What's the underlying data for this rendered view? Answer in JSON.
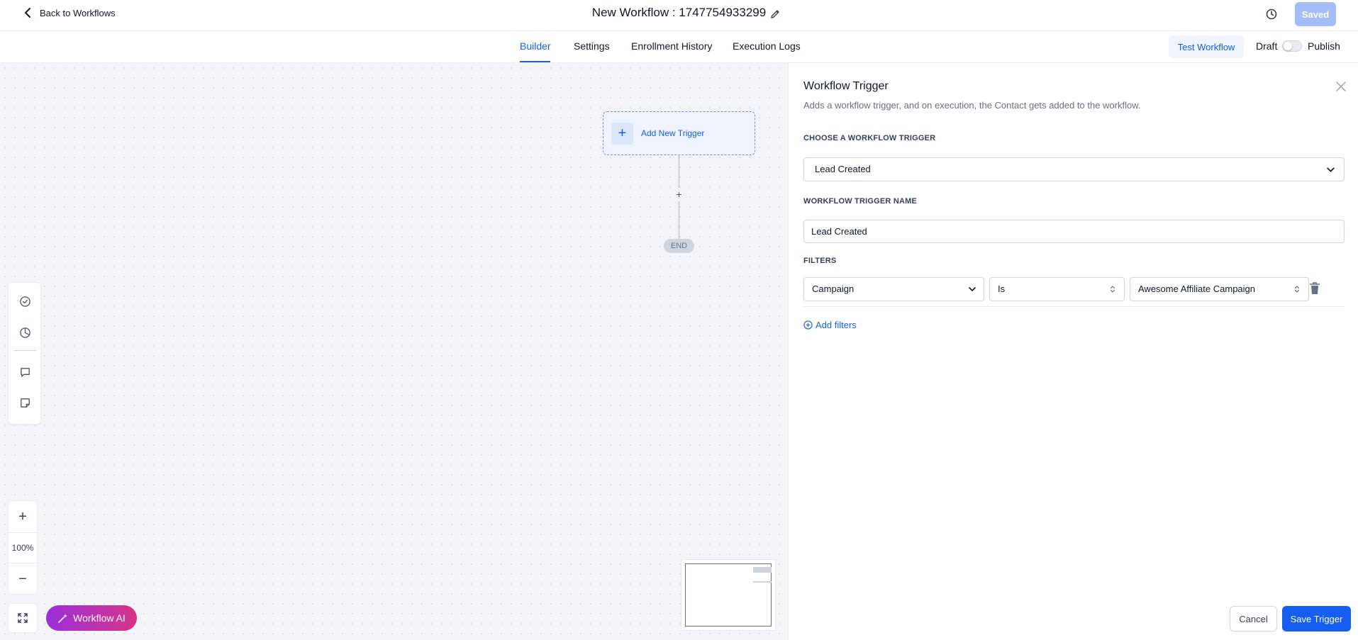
{
  "header": {
    "back_label": "Back to Workflows",
    "title": "New Workflow : 1747754933299",
    "saved_label": "Saved"
  },
  "tabs": [
    {
      "label": "Builder",
      "active": true
    },
    {
      "label": "Settings",
      "active": false
    },
    {
      "label": "Enrollment History",
      "active": false
    },
    {
      "label": "Execution Logs",
      "active": false
    }
  ],
  "actions": {
    "test_workflow": "Test Workflow",
    "draft": "Draft",
    "publish": "Publish"
  },
  "canvas": {
    "add_trigger": "Add New Trigger",
    "add_step": "+",
    "end_label": "END",
    "zoom_level": "100%",
    "workflow_ai": "Workflow AI"
  },
  "panel": {
    "title": "Workflow Trigger",
    "description": "Adds a workflow trigger, and on execution, the Contact gets added to the workflow.",
    "choose_label": "CHOOSE A WORKFLOW TRIGGER",
    "choose_value": "Lead Created",
    "name_label": "WORKFLOW TRIGGER NAME",
    "name_value": "Lead Created",
    "filters_label": "FILTERS",
    "filter": {
      "field": "Campaign",
      "operator": "Is",
      "value": "Awesome Affiliate Campaign"
    },
    "add_filters": "Add filters",
    "cancel": "Cancel",
    "save": "Save Trigger"
  },
  "colors": {
    "accent": "#155eef",
    "saved_button": "#a4bcf7",
    "ai_gradient_start": "#9b2fd8",
    "ai_gradient_end": "#d6358a"
  }
}
